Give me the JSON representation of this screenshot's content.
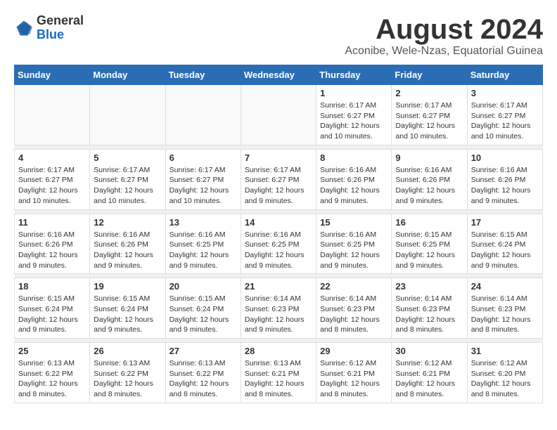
{
  "logo": {
    "general": "General",
    "blue": "Blue"
  },
  "title": "August 2024",
  "subtitle": "Aconibe, Wele-Nzas, Equatorial Guinea",
  "days_of_week": [
    "Sunday",
    "Monday",
    "Tuesday",
    "Wednesday",
    "Thursday",
    "Friday",
    "Saturday"
  ],
  "weeks": [
    {
      "days": [
        {
          "num": "",
          "info": ""
        },
        {
          "num": "",
          "info": ""
        },
        {
          "num": "",
          "info": ""
        },
        {
          "num": "",
          "info": ""
        },
        {
          "num": "1",
          "info": "Sunrise: 6:17 AM\nSunset: 6:27 PM\nDaylight: 12 hours\nand 10 minutes."
        },
        {
          "num": "2",
          "info": "Sunrise: 6:17 AM\nSunset: 6:27 PM\nDaylight: 12 hours\nand 10 minutes."
        },
        {
          "num": "3",
          "info": "Sunrise: 6:17 AM\nSunset: 6:27 PM\nDaylight: 12 hours\nand 10 minutes."
        }
      ]
    },
    {
      "days": [
        {
          "num": "4",
          "info": "Sunrise: 6:17 AM\nSunset: 6:27 PM\nDaylight: 12 hours\nand 10 minutes."
        },
        {
          "num": "5",
          "info": "Sunrise: 6:17 AM\nSunset: 6:27 PM\nDaylight: 12 hours\nand 10 minutes."
        },
        {
          "num": "6",
          "info": "Sunrise: 6:17 AM\nSunset: 6:27 PM\nDaylight: 12 hours\nand 10 minutes."
        },
        {
          "num": "7",
          "info": "Sunrise: 6:17 AM\nSunset: 6:27 PM\nDaylight: 12 hours\nand 9 minutes."
        },
        {
          "num": "8",
          "info": "Sunrise: 6:16 AM\nSunset: 6:26 PM\nDaylight: 12 hours\nand 9 minutes."
        },
        {
          "num": "9",
          "info": "Sunrise: 6:16 AM\nSunset: 6:26 PM\nDaylight: 12 hours\nand 9 minutes."
        },
        {
          "num": "10",
          "info": "Sunrise: 6:16 AM\nSunset: 6:26 PM\nDaylight: 12 hours\nand 9 minutes."
        }
      ]
    },
    {
      "days": [
        {
          "num": "11",
          "info": "Sunrise: 6:16 AM\nSunset: 6:26 PM\nDaylight: 12 hours\nand 9 minutes."
        },
        {
          "num": "12",
          "info": "Sunrise: 6:16 AM\nSunset: 6:26 PM\nDaylight: 12 hours\nand 9 minutes."
        },
        {
          "num": "13",
          "info": "Sunrise: 6:16 AM\nSunset: 6:25 PM\nDaylight: 12 hours\nand 9 minutes."
        },
        {
          "num": "14",
          "info": "Sunrise: 6:16 AM\nSunset: 6:25 PM\nDaylight: 12 hours\nand 9 minutes."
        },
        {
          "num": "15",
          "info": "Sunrise: 6:16 AM\nSunset: 6:25 PM\nDaylight: 12 hours\nand 9 minutes."
        },
        {
          "num": "16",
          "info": "Sunrise: 6:15 AM\nSunset: 6:25 PM\nDaylight: 12 hours\nand 9 minutes."
        },
        {
          "num": "17",
          "info": "Sunrise: 6:15 AM\nSunset: 6:24 PM\nDaylight: 12 hours\nand 9 minutes."
        }
      ]
    },
    {
      "days": [
        {
          "num": "18",
          "info": "Sunrise: 6:15 AM\nSunset: 6:24 PM\nDaylight: 12 hours\nand 9 minutes."
        },
        {
          "num": "19",
          "info": "Sunrise: 6:15 AM\nSunset: 6:24 PM\nDaylight: 12 hours\nand 9 minutes."
        },
        {
          "num": "20",
          "info": "Sunrise: 6:15 AM\nSunset: 6:24 PM\nDaylight: 12 hours\nand 9 minutes."
        },
        {
          "num": "21",
          "info": "Sunrise: 6:14 AM\nSunset: 6:23 PM\nDaylight: 12 hours\nand 9 minutes."
        },
        {
          "num": "22",
          "info": "Sunrise: 6:14 AM\nSunset: 6:23 PM\nDaylight: 12 hours\nand 8 minutes."
        },
        {
          "num": "23",
          "info": "Sunrise: 6:14 AM\nSunset: 6:23 PM\nDaylight: 12 hours\nand 8 minutes."
        },
        {
          "num": "24",
          "info": "Sunrise: 6:14 AM\nSunset: 6:23 PM\nDaylight: 12 hours\nand 8 minutes."
        }
      ]
    },
    {
      "days": [
        {
          "num": "25",
          "info": "Sunrise: 6:13 AM\nSunset: 6:22 PM\nDaylight: 12 hours\nand 8 minutes."
        },
        {
          "num": "26",
          "info": "Sunrise: 6:13 AM\nSunset: 6:22 PM\nDaylight: 12 hours\nand 8 minutes."
        },
        {
          "num": "27",
          "info": "Sunrise: 6:13 AM\nSunset: 6:22 PM\nDaylight: 12 hours\nand 8 minutes."
        },
        {
          "num": "28",
          "info": "Sunrise: 6:13 AM\nSunset: 6:21 PM\nDaylight: 12 hours\nand 8 minutes."
        },
        {
          "num": "29",
          "info": "Sunrise: 6:12 AM\nSunset: 6:21 PM\nDaylight: 12 hours\nand 8 minutes."
        },
        {
          "num": "30",
          "info": "Sunrise: 6:12 AM\nSunset: 6:21 PM\nDaylight: 12 hours\nand 8 minutes."
        },
        {
          "num": "31",
          "info": "Sunrise: 6:12 AM\nSunset: 6:20 PM\nDaylight: 12 hours\nand 8 minutes."
        }
      ]
    }
  ]
}
